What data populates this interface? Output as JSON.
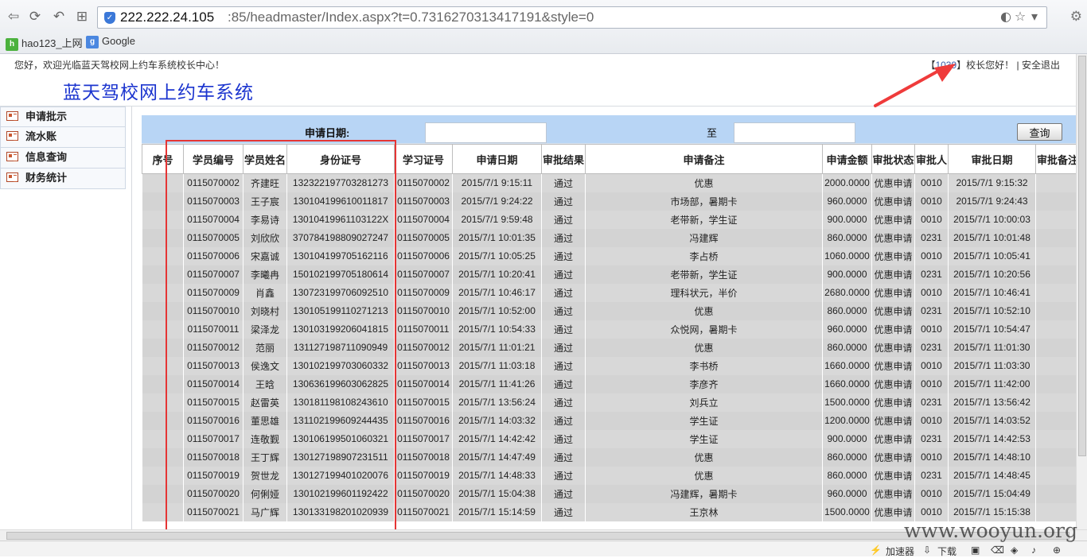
{
  "browser": {
    "url_host": "222.222.24.105",
    "url_rest": ":85/headmaster/Index.aspx?t=0.7316270313417191&style=0",
    "bookmarks": [
      {
        "label": "hao123_上网"
      },
      {
        "label": "Google"
      }
    ],
    "status_items": [
      "加速器",
      "下载"
    ]
  },
  "header": {
    "welcome": "您好，欢迎光临蓝天驾校网上约车系统校长中心！",
    "user_id": "1039",
    "greeting": "校长您好！",
    "logout": "安全退出",
    "title": "蓝天驾校网上约车系统"
  },
  "sidebar": {
    "items": [
      {
        "label": "申请批示"
      },
      {
        "label": "流水账"
      },
      {
        "label": "信息查询"
      },
      {
        "label": "财务统计"
      }
    ]
  },
  "search": {
    "date_label": "申请日期:",
    "to_label": "至",
    "query_label": "查询"
  },
  "table": {
    "columns": [
      "序号",
      "学员编号",
      "学员姓名",
      "身份证号",
      "学习证号",
      "申请日期",
      "审批结果",
      "申请备注",
      "申请金额",
      "审批状态",
      "审批人",
      "审批日期",
      "审批备注"
    ],
    "rows": [
      [
        "",
        "0115070002",
        "齐建旺",
        "132322197703281273",
        "0115070002",
        "2015/7/1 9:15:11",
        "通过",
        "优惠",
        "2000.0000",
        "优惠申请",
        "0010",
        "2015/7/1 9:15:32",
        ""
      ],
      [
        "",
        "0115070003",
        "王子宸",
        "130104199610011817",
        "0115070003",
        "2015/7/1 9:24:22",
        "通过",
        "市场部，暑期卡",
        "960.0000",
        "优惠申请",
        "0010",
        "2015/7/1 9:24:43",
        ""
      ],
      [
        "",
        "0115070004",
        "李易诗",
        "13010419961103122X",
        "0115070004",
        "2015/7/1 9:59:48",
        "通过",
        "老带新，学生证",
        "900.0000",
        "优惠申请",
        "0010",
        "2015/7/1 10:00:03",
        ""
      ],
      [
        "",
        "0115070005",
        "刘欣欣",
        "370784198809027247",
        "0115070005",
        "2015/7/1 10:01:35",
        "通过",
        "冯建辉",
        "860.0000",
        "优惠申请",
        "0231",
        "2015/7/1 10:01:48",
        ""
      ],
      [
        "",
        "0115070006",
        "宋嘉诚",
        "130104199705162116",
        "0115070006",
        "2015/7/1 10:05:25",
        "通过",
        "李占桥",
        "1060.0000",
        "优惠申请",
        "0010",
        "2015/7/1 10:05:41",
        ""
      ],
      [
        "",
        "0115070007",
        "李曦冉",
        "150102199705180614",
        "0115070007",
        "2015/7/1 10:20:41",
        "通过",
        "老带新，学生证",
        "900.0000",
        "优惠申请",
        "0231",
        "2015/7/1 10:20:56",
        ""
      ],
      [
        "",
        "0115070009",
        "肖鑫",
        "130723199706092510",
        "0115070009",
        "2015/7/1 10:46:17",
        "通过",
        "理科状元，半价",
        "2680.0000",
        "优惠申请",
        "0010",
        "2015/7/1 10:46:41",
        ""
      ],
      [
        "",
        "0115070010",
        "刘晓村",
        "130105199110271213",
        "0115070010",
        "2015/7/1 10:52:00",
        "通过",
        "优惠",
        "860.0000",
        "优惠申请",
        "0231",
        "2015/7/1 10:52:10",
        ""
      ],
      [
        "",
        "0115070011",
        "梁泽龙",
        "130103199206041815",
        "0115070011",
        "2015/7/1 10:54:33",
        "通过",
        "众悦网，暑期卡",
        "960.0000",
        "优惠申请",
        "0010",
        "2015/7/1 10:54:47",
        ""
      ],
      [
        "",
        "0115070012",
        "范丽",
        "131127198711090949",
        "0115070012",
        "2015/7/1 11:01:21",
        "通过",
        "优惠",
        "860.0000",
        "优惠申请",
        "0231",
        "2015/7/1 11:01:30",
        ""
      ],
      [
        "",
        "0115070013",
        "侯逸文",
        "130102199703060332",
        "0115070013",
        "2015/7/1 11:03:18",
        "通过",
        "李书桥",
        "1660.0000",
        "优惠申请",
        "0010",
        "2015/7/1 11:03:30",
        ""
      ],
      [
        "",
        "0115070014",
        "王晗",
        "130636199603062825",
        "0115070014",
        "2015/7/1 11:41:26",
        "通过",
        "李彦齐",
        "1660.0000",
        "优惠申请",
        "0010",
        "2015/7/1 11:42:00",
        ""
      ],
      [
        "",
        "0115070015",
        "赵雷英",
        "130181198108243610",
        "0115070015",
        "2015/7/1 13:56:24",
        "通过",
        "刘兵立",
        "1500.0000",
        "优惠申请",
        "0231",
        "2015/7/1 13:56:42",
        ""
      ],
      [
        "",
        "0115070016",
        "董思雄",
        "131102199609244435",
        "0115070016",
        "2015/7/1 14:03:32",
        "通过",
        "学生证",
        "1200.0000",
        "优惠申请",
        "0010",
        "2015/7/1 14:03:52",
        ""
      ],
      [
        "",
        "0115070017",
        "连敬觐",
        "130106199501060321",
        "0115070017",
        "2015/7/1 14:42:42",
        "通过",
        "学生证",
        "900.0000",
        "优惠申请",
        "0231",
        "2015/7/1 14:42:53",
        ""
      ],
      [
        "",
        "0115070018",
        "王丁辉",
        "130127198907231511",
        "0115070018",
        "2015/7/1 14:47:49",
        "通过",
        "优惠",
        "860.0000",
        "优惠申请",
        "0010",
        "2015/7/1 14:48:10",
        ""
      ],
      [
        "",
        "0115070019",
        "贺世龙",
        "130127199401020076",
        "0115070019",
        "2015/7/1 14:48:33",
        "通过",
        "优惠",
        "860.0000",
        "优惠申请",
        "0231",
        "2015/7/1 14:48:45",
        ""
      ],
      [
        "",
        "0115070020",
        "何俐娅",
        "130102199601192422",
        "0115070020",
        "2015/7/1 15:04:38",
        "通过",
        "冯建辉，暑期卡",
        "960.0000",
        "优惠申请",
        "0010",
        "2015/7/1 15:04:49",
        ""
      ],
      [
        "",
        "0115070021",
        "马广辉",
        "130133198201020939",
        "0115070021",
        "2015/7/1 15:14:59",
        "通过",
        "王京林",
        "1500.0000",
        "优惠申请",
        "0010",
        "2015/7/1 15:15:38",
        ""
      ]
    ]
  },
  "watermark": "www.wooyun.org"
}
